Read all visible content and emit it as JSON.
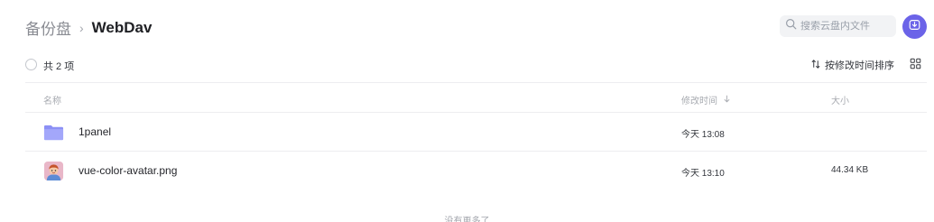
{
  "breadcrumb": {
    "root": "备份盘",
    "separator": "›",
    "current": "WebDav"
  },
  "search": {
    "placeholder": "搜索云盘内文件"
  },
  "toolbar": {
    "count_label": "共 2 项",
    "sort_label": "按修改时间排序"
  },
  "table": {
    "headers": {
      "name": "名称",
      "mtime": "修改时间",
      "size": "大小"
    },
    "rows": [
      {
        "type": "folder",
        "name": "1panel",
        "mtime": "今天 13:08",
        "size": ""
      },
      {
        "type": "image",
        "name": "vue-color-avatar.png",
        "mtime": "今天 13:10",
        "size": "44.34 KB"
      }
    ]
  },
  "footer": {
    "no_more": "没有更多了"
  },
  "colors": {
    "accent": "#6b63e8",
    "folder": "#8c90f5",
    "border": "#ededf0",
    "muted_text": "#a7aab0"
  },
  "icons": {
    "search": "search-icon",
    "download": "download-icon",
    "sort": "sort-arrows-icon",
    "view": "grid-view-icon",
    "folder": "folder-icon",
    "image": "image-file-icon"
  }
}
